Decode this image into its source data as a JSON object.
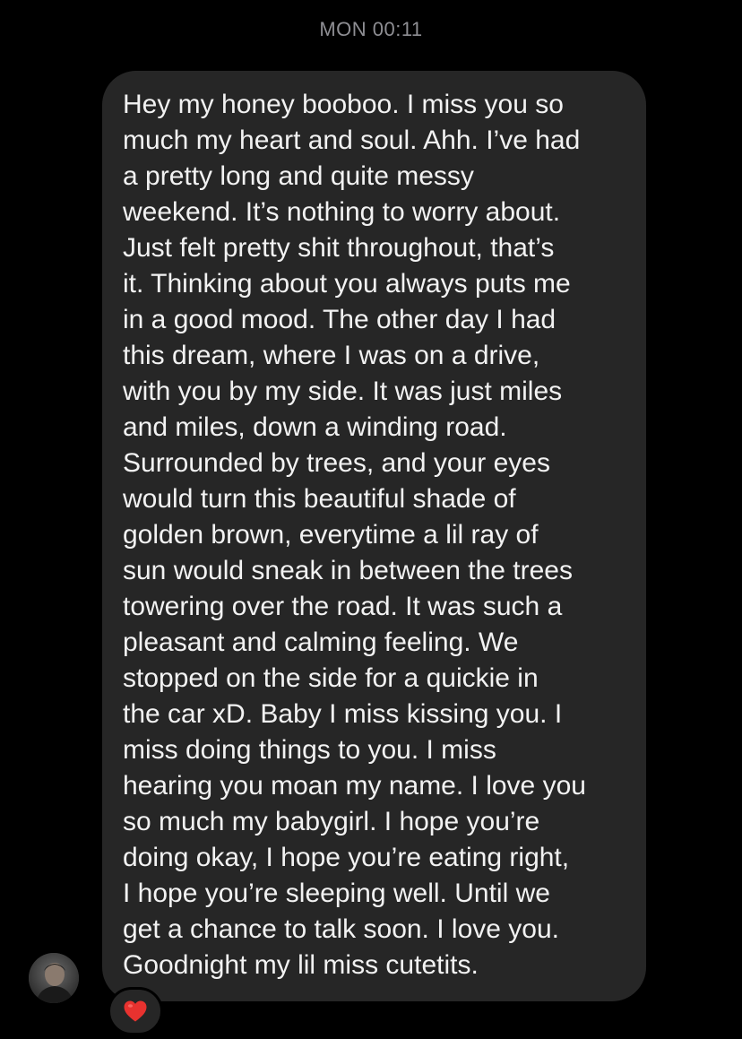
{
  "header": {
    "timestamp": "MON 00:11"
  },
  "message": {
    "text": "Hey my honey booboo. I miss you so\nmuch my heart and soul. Ahh. I’ve had\na pretty long and quite messy\nweekend. It’s nothing to worry about.\nJust felt pretty shit throughout, that’s\nit. Thinking about you always puts me\nin a good mood. The other day I had\nthis dream, where I was on a drive,\nwith you by my side. It was just miles\nand miles, down a winding road.\nSurrounded by trees, and your eyes\nwould turn this beautiful shade of\ngolden brown, everytime a lil ray of\nsun would sneak in between the trees\ntowering over the road. It was such a\npleasant and calming feeling. We\nstopped on the side for a quickie in\nthe car xD. Baby I miss kissing you. I\nmiss doing things to you. I miss\nhearing you moan my name. I love you\nso much my babygirl. I hope you’re\ndoing okay, I hope you’re eating right,\nI hope you’re sleeping well. Until we\nget a chance to talk soon. I love you.\nGoodnight my lil miss cutetits.",
    "bubble_color": "#262626",
    "text_color": "#f2f2f2"
  },
  "sender": {
    "avatar_icon": "profile-photo"
  },
  "reaction": {
    "icon": "red-heart-icon",
    "color": "#e8322f"
  }
}
